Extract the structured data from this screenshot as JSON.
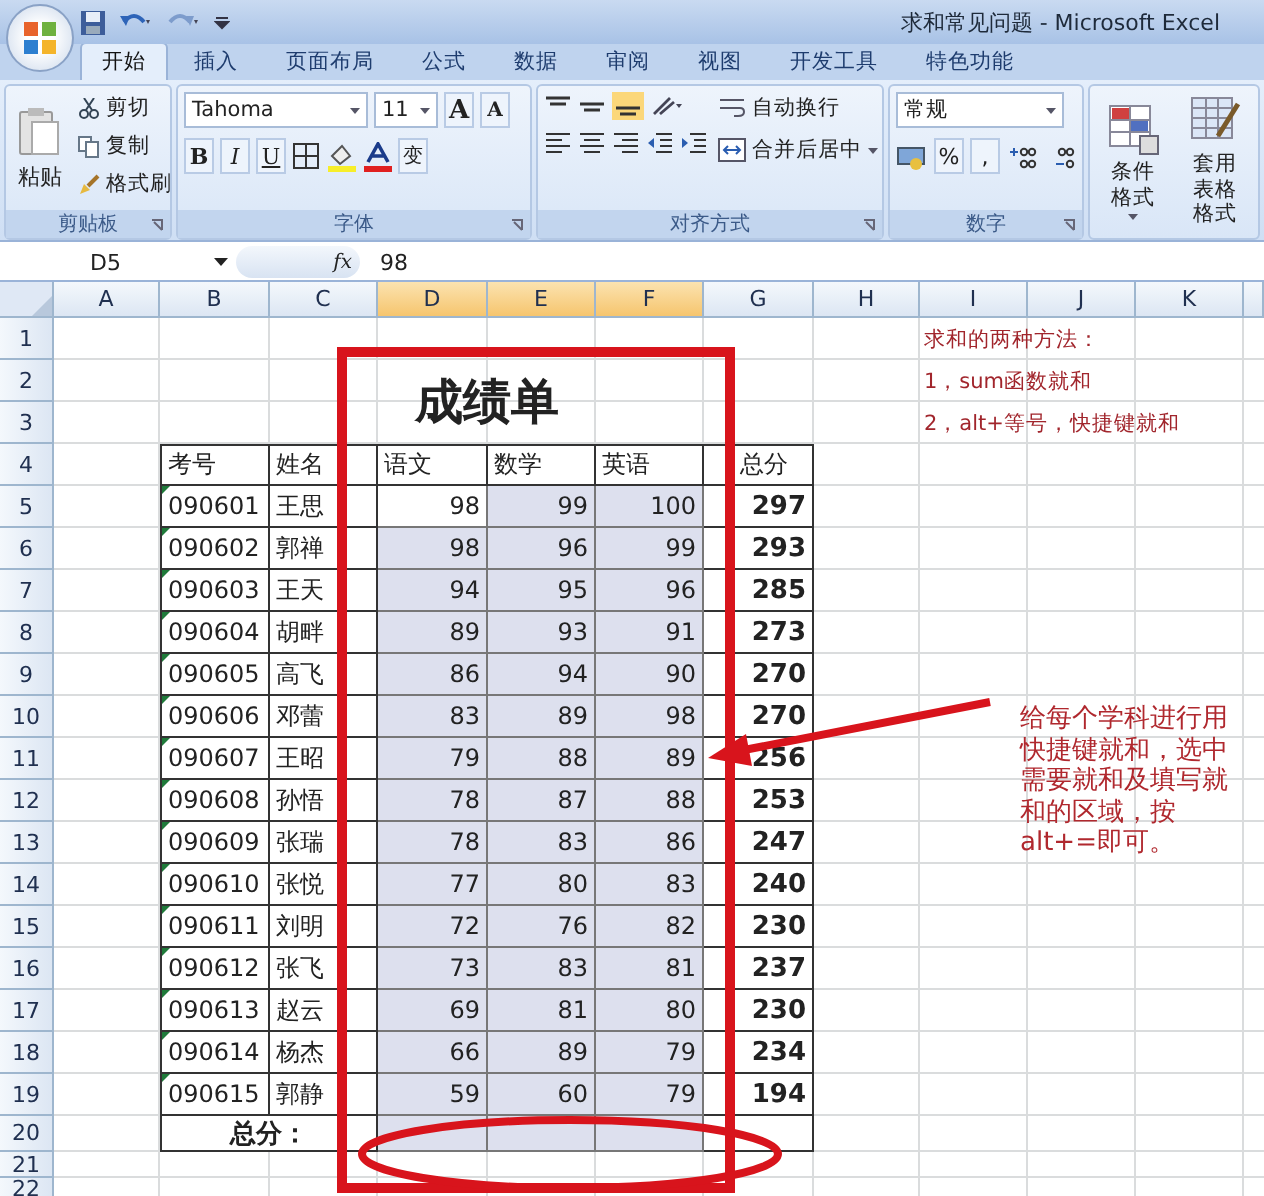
{
  "window": {
    "title": "求和常见问题 - Microsoft Excel"
  },
  "tabs": [
    {
      "label": "开始",
      "selected": true
    },
    {
      "label": "插入",
      "selected": false
    },
    {
      "label": "页面布局",
      "selected": false
    },
    {
      "label": "公式",
      "selected": false
    },
    {
      "label": "数据",
      "selected": false
    },
    {
      "label": "审阅",
      "selected": false
    },
    {
      "label": "视图",
      "selected": false
    },
    {
      "label": "开发工具",
      "selected": false
    },
    {
      "label": "特色功能",
      "selected": false
    }
  ],
  "ribbon": {
    "clipboard": {
      "label": "剪贴板",
      "paste": "粘贴",
      "commands": [
        "剪切",
        "复制",
        "格式刷"
      ]
    },
    "font": {
      "label": "字体",
      "font_name": "Tahoma",
      "font_size": "11",
      "grow_shrink": [
        "A",
        "A"
      ],
      "styles": [
        "B",
        "I",
        "U"
      ],
      "phonetic": "变"
    },
    "alignment": {
      "label": "对齐方式",
      "wrap_text": "自动换行",
      "merge_center": "合并后居中"
    },
    "number": {
      "label": "数字",
      "format": "常规",
      "percent": "%",
      "comma": ","
    },
    "styles": {
      "conditional_format": "条件格式",
      "table_format": [
        "套用",
        "表格格式"
      ]
    }
  },
  "formula_bar": {
    "name_box": "D5",
    "fx": "fx",
    "value": "98"
  },
  "sheet": {
    "column_headers": [
      {
        "label": "A",
        "selected": false
      },
      {
        "label": "B",
        "selected": false
      },
      {
        "label": "C",
        "selected": false
      },
      {
        "label": "D",
        "selected": true
      },
      {
        "label": "E",
        "selected": true
      },
      {
        "label": "F",
        "selected": true
      },
      {
        "label": "G",
        "selected": false
      },
      {
        "label": "H",
        "selected": false
      },
      {
        "label": "I",
        "selected": false
      },
      {
        "label": "J",
        "selected": false
      },
      {
        "label": "K",
        "selected": false
      }
    ],
    "row_headers": [
      "1",
      "2",
      "3",
      "4",
      "5",
      "6",
      "7",
      "8",
      "9",
      "10",
      "11",
      "12",
      "13",
      "14",
      "15",
      "16",
      "17",
      "18",
      "19",
      "20",
      "21",
      "22"
    ],
    "notes": [
      "求和的两种方法：",
      "1，sum函数就和",
      "2，alt+等号，快捷键就和"
    ],
    "title": "成绩单",
    "table": {
      "columns": [
        "考号",
        "姓名",
        "语文",
        "数学",
        "英语",
        "总分"
      ],
      "rows": [
        {
          "id": "090601",
          "name": "王思",
          "scores": [
            "98",
            "99",
            "100"
          ],
          "total": "297"
        },
        {
          "id": "090602",
          "name": "郭禅",
          "scores": [
            "98",
            "96",
            "99"
          ],
          "total": "293"
        },
        {
          "id": "090603",
          "name": "王天",
          "scores": [
            "94",
            "95",
            "96"
          ],
          "total": "285"
        },
        {
          "id": "090604",
          "name": "胡畔",
          "scores": [
            "89",
            "93",
            "91"
          ],
          "total": "273"
        },
        {
          "id": "090605",
          "name": "高飞",
          "scores": [
            "86",
            "94",
            "90"
          ],
          "total": "270"
        },
        {
          "id": "090606",
          "name": "邓蕾",
          "scores": [
            "83",
            "89",
            "98"
          ],
          "total": "270"
        },
        {
          "id": "090607",
          "name": "王昭",
          "scores": [
            "79",
            "88",
            "89"
          ],
          "total": "256"
        },
        {
          "id": "090608",
          "name": "孙悟",
          "scores": [
            "78",
            "87",
            "88"
          ],
          "total": "253"
        },
        {
          "id": "090609",
          "name": "张瑞",
          "scores": [
            "78",
            "83",
            "86"
          ],
          "total": "247"
        },
        {
          "id": "090610",
          "name": "张悦",
          "scores": [
            "77",
            "80",
            "83"
          ],
          "total": "240"
        },
        {
          "id": "090611",
          "name": "刘明",
          "scores": [
            "72",
            "76",
            "82"
          ],
          "total": "230"
        },
        {
          "id": "090612",
          "name": "张飞",
          "scores": [
            "73",
            "83",
            "81"
          ],
          "total": "237"
        },
        {
          "id": "090613",
          "name": "赵云",
          "scores": [
            "69",
            "81",
            "80"
          ],
          "total": "230"
        },
        {
          "id": "090614",
          "name": "杨杰",
          "scores": [
            "66",
            "89",
            "79"
          ],
          "total": "234"
        },
        {
          "id": "090615",
          "name": "郭静",
          "scores": [
            "59",
            "60",
            "79"
          ],
          "total": "194"
        }
      ],
      "footer_label": "总分："
    },
    "callout": [
      "给每个学科进行用",
      "快捷键就和，选中",
      "需要就和及填写就",
      "和的区域，按",
      "alt+=即可。"
    ]
  }
}
